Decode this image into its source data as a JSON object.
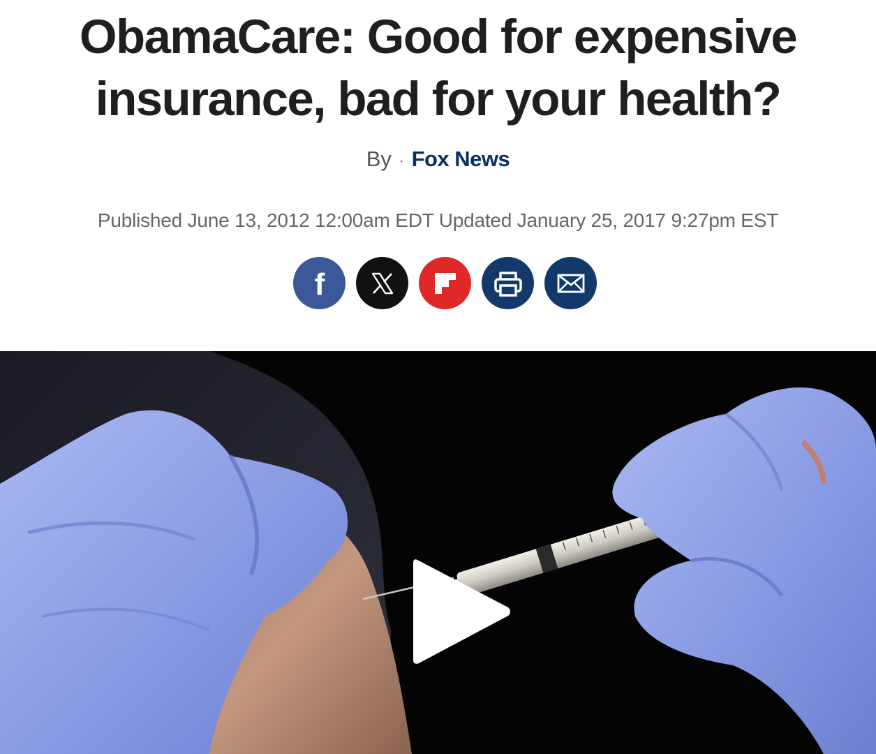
{
  "article": {
    "headline_line1": "ObamaCare: Good for expensive",
    "headline_line2": "insurance, bad for your health?",
    "by_label": "By",
    "separator": "·",
    "author": "Fox News",
    "dates": "Published June 13, 2012 12:00am EDT Updated January 25, 2017 9:27pm EST"
  },
  "share": {
    "buttons": [
      {
        "name": "facebook",
        "icon": "facebook-icon",
        "color": "#3b5998"
      },
      {
        "name": "x",
        "icon": "x-icon",
        "color": "#111111"
      },
      {
        "name": "flipboard",
        "icon": "flipboard-icon",
        "color": "#e12828"
      },
      {
        "name": "print",
        "icon": "print-icon",
        "color": "#13396b"
      },
      {
        "name": "email",
        "icon": "email-icon",
        "color": "#13396b"
      }
    ]
  },
  "video": {
    "thumbnail": "gloved hands giving an injection into upper arm",
    "play_icon": "play-icon"
  },
  "colors": {
    "headline": "#1f1f1f",
    "author_link": "#0b2e63",
    "meta_text": "#666666"
  }
}
